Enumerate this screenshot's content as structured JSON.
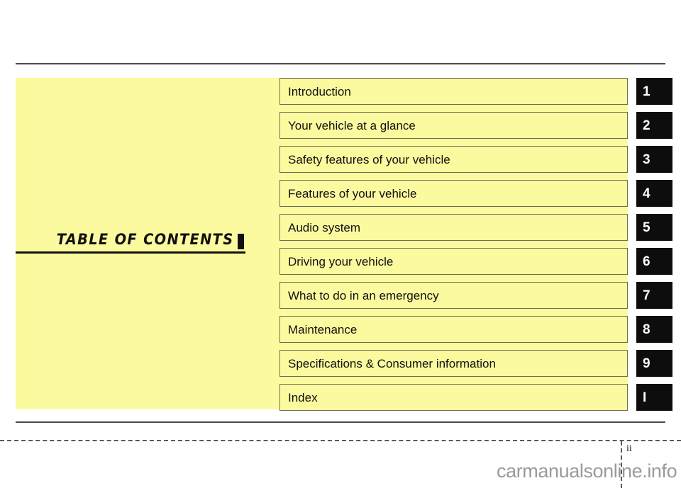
{
  "page": {
    "title": "TABLE OF CONTENTS",
    "page_number": "ii",
    "watermark": "carmanualsonline.info",
    "panel_color": "#FCFA9E",
    "number_box_color": "#0D0D0D",
    "number_text_color": "#FFFFFF"
  },
  "contents": {
    "rows": [
      {
        "label": "Introduction",
        "number": "1"
      },
      {
        "label": "Your vehicle at a glance",
        "number": "2"
      },
      {
        "label": "Safety features of your vehicle",
        "number": "3"
      },
      {
        "label": "Features of your vehicle",
        "number": "4"
      },
      {
        "label": "Audio system",
        "number": "5"
      },
      {
        "label": "Driving your vehicle",
        "number": "6"
      },
      {
        "label": "What to do in an emergency",
        "number": "7"
      },
      {
        "label": "Maintenance",
        "number": "8"
      },
      {
        "label": "Specifications & Consumer information",
        "number": "9"
      },
      {
        "label": "Index",
        "number": "I"
      }
    ]
  }
}
